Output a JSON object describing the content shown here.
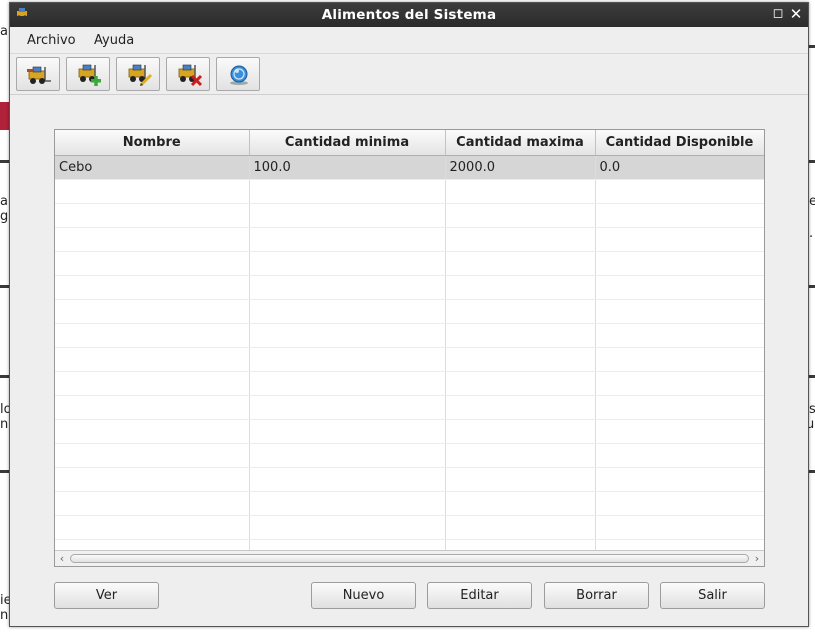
{
  "window": {
    "title": "Alimentos del Sistema",
    "maximize_symbol": "◻",
    "close_symbol": "✕"
  },
  "menu": {
    "items": [
      "Archivo",
      "Ayuda"
    ]
  },
  "toolbar": {
    "buttons": [
      {
        "icon": "forklift-view-icon"
      },
      {
        "icon": "forklift-add-icon"
      },
      {
        "icon": "forklift-edit-icon"
      },
      {
        "icon": "forklift-delete-icon"
      },
      {
        "icon": "info-globe-icon"
      }
    ]
  },
  "table": {
    "columns": [
      "Nombre",
      "Cantidad minima",
      "Cantidad maxima",
      "Cantidad Disponible"
    ],
    "rows": [
      [
        "Cebo",
        "100.0",
        "2000.0",
        "0.0"
      ]
    ],
    "scroll_left": "‹",
    "scroll_right": "›"
  },
  "buttons": {
    "ver": "Ver",
    "nuevo": "Nuevo",
    "editar": "Editar",
    "borrar": "Borrar",
    "salir": "Salir"
  },
  "background": {
    "left_fragments": [
      "al",
      "a",
      "g",
      "lo",
      "ng",
      "ie",
      "n"
    ],
    "right_fragments": [
      "e",
      ".",
      "s",
      "ue"
    ]
  }
}
